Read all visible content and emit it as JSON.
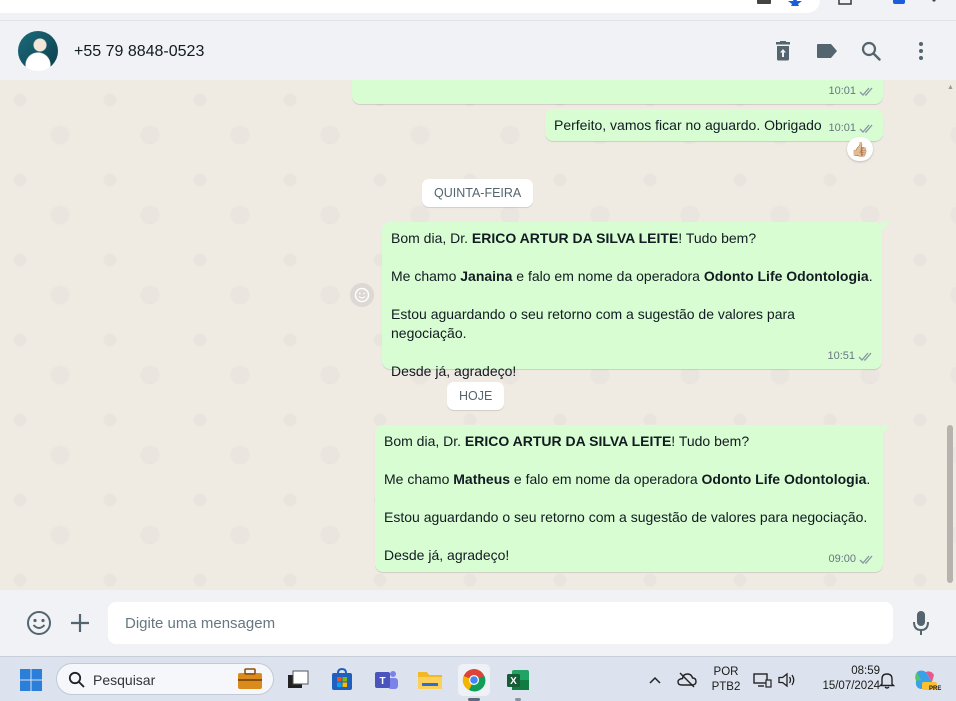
{
  "chat": {
    "contact_name": "+55 79 8848-0523",
    "header_icons": [
      "delete-icon",
      "label-icon",
      "search-icon",
      "menu-icon"
    ]
  },
  "messages": {
    "m1": {
      "time": "10:01"
    },
    "m2": {
      "text": "Perfeito, vamos ficar no aguardo. Obrigado",
      "time": "10:01",
      "reaction": "👍🏼"
    },
    "day1": "QUINTA-FEIRA",
    "m3": {
      "l1_pre": "Bom dia, Dr. ",
      "l1_bold": "ERICO ARTUR DA SILVA LEITE",
      "l1_post": "! Tudo bem?",
      "l2_pre": "Me chamo ",
      "l2_bold1": "Janaina",
      "l2_mid": " e falo em nome da operadora ",
      "l2_bold2": "Odonto Life Odontologia",
      "l2_post": ".",
      "l3": "Estou aguardando o seu retorno com a sugestão de valores para negociação.",
      "l4": "Desde já, agradeço!",
      "time": "10:51"
    },
    "day2": "HOJE",
    "m4": {
      "l1_pre": "Bom dia, Dr. ",
      "l1_bold": "ERICO ARTUR DA SILVA LEITE",
      "l1_post": "! Tudo bem?",
      "l2_pre": "Me chamo ",
      "l2_bold1": "Matheus",
      "l2_mid": " e falo em nome da operadora ",
      "l2_bold2": "Odonto Life Odontologia",
      "l2_post": ".",
      "l3": "Estou aguardando o seu retorno com a sugestão de valores para negociação.",
      "l4": "Desde já, agradeço!",
      "time": "09:00"
    }
  },
  "composer": {
    "placeholder": "Digite uma mensagem"
  },
  "taskbar": {
    "search_label": "Pesquisar",
    "lang_top": "POR",
    "lang_bottom": "PTB2",
    "clock_time": "08:59",
    "clock_date": "15/07/2024",
    "copilot_badge": "PRE"
  },
  "colors": {
    "outgoing_bubble": "#d9fdd3",
    "chat_background": "#efeae2",
    "read_ticks": "#8696a0"
  }
}
